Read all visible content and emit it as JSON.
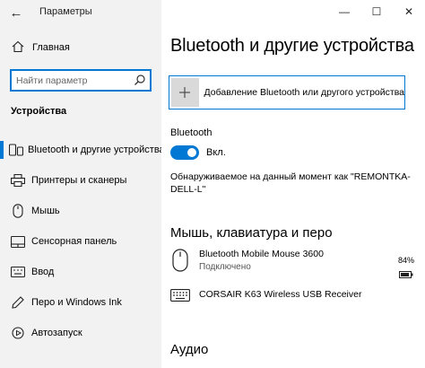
{
  "window": {
    "title": "Параметры",
    "back_glyph": "←",
    "minimize_glyph": "—",
    "maximize_glyph": "☐",
    "close_glyph": "✕"
  },
  "sidebar": {
    "home_label": "Главная",
    "search_placeholder": "Найти параметр",
    "section_title": "Устройства",
    "items": [
      {
        "label": "Bluetooth и другие устройства",
        "icon": "bluetooth-devices-icon",
        "selected": true
      },
      {
        "label": "Принтеры и сканеры",
        "icon": "printer-icon",
        "selected": false
      },
      {
        "label": "Мышь",
        "icon": "mouse-icon",
        "selected": false
      },
      {
        "label": "Сенсорная панель",
        "icon": "touchpad-icon",
        "selected": false
      },
      {
        "label": "Ввод",
        "icon": "keyboard-icon",
        "selected": false
      },
      {
        "label": "Перо и Windows Ink",
        "icon": "pen-icon",
        "selected": false
      },
      {
        "label": "Автозапуск",
        "icon": "autoplay-icon",
        "selected": false
      }
    ]
  },
  "main": {
    "title": "Bluetooth и другие устройства",
    "add_device_label": "Добавление Bluetooth или другого устройства",
    "bluetooth_label": "Bluetooth",
    "toggle_state_label": "Вкл.",
    "discoverable_text": "Обнаруживаемое на данный момент как \"REMONTKA-DELL-L\"",
    "section_mouse_title": "Мышь, клавиатура и перо",
    "devices": [
      {
        "name": "Bluetooth Mobile Mouse 3600",
        "status": "Подключено",
        "battery": "84%",
        "icon": "mouse-icon"
      },
      {
        "name": "CORSAIR K63 Wireless USB Receiver",
        "status": "",
        "battery": "",
        "icon": "keyboard-icon"
      }
    ],
    "section_audio_title": "Аудио"
  },
  "colors": {
    "accent": "#0078d4",
    "sidebar_bg": "#f2f2f2",
    "content_bg": "#ffffff"
  }
}
